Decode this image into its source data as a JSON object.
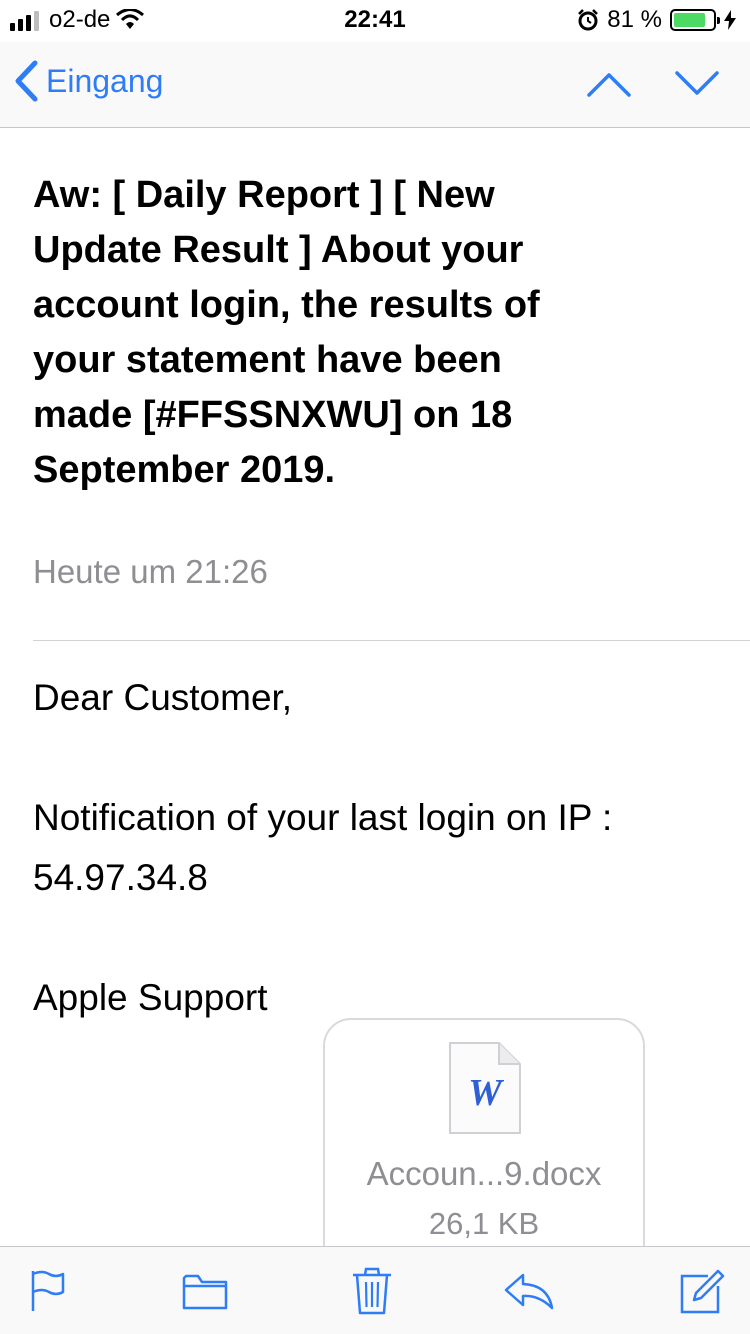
{
  "status_bar": {
    "carrier": "o2-de",
    "time": "22:41",
    "battery_percent": "81 %",
    "signal_bars": 4,
    "signal_bars_filled": 3,
    "battery_level": 0.81
  },
  "nav": {
    "back_label": "Eingang"
  },
  "email": {
    "subject": "Aw: [ Daily Report ] [ New Update Result ] About your account login, the results of your statement have been made [#FFSSNXWU] on 18 September 2019.",
    "date": "Heute um 21:26",
    "greeting": "Dear Customer,",
    "notification": "Notification of your last login on IP : 54.97.34.8",
    "signoff": "Apple Support"
  },
  "attachment": {
    "name": "Accoun...9.docx",
    "size": "26,1 KB",
    "icon": "word-document-icon",
    "icon_letter": "W"
  },
  "toolbar": {
    "icons": [
      "flag-icon",
      "folder-icon",
      "trash-icon",
      "reply-icon",
      "compose-icon"
    ]
  },
  "colors": {
    "accent": "#2f7df6",
    "secondary_text": "#8e8e93",
    "battery_fill": "#4cd964",
    "separator": "#c8c7cc"
  }
}
